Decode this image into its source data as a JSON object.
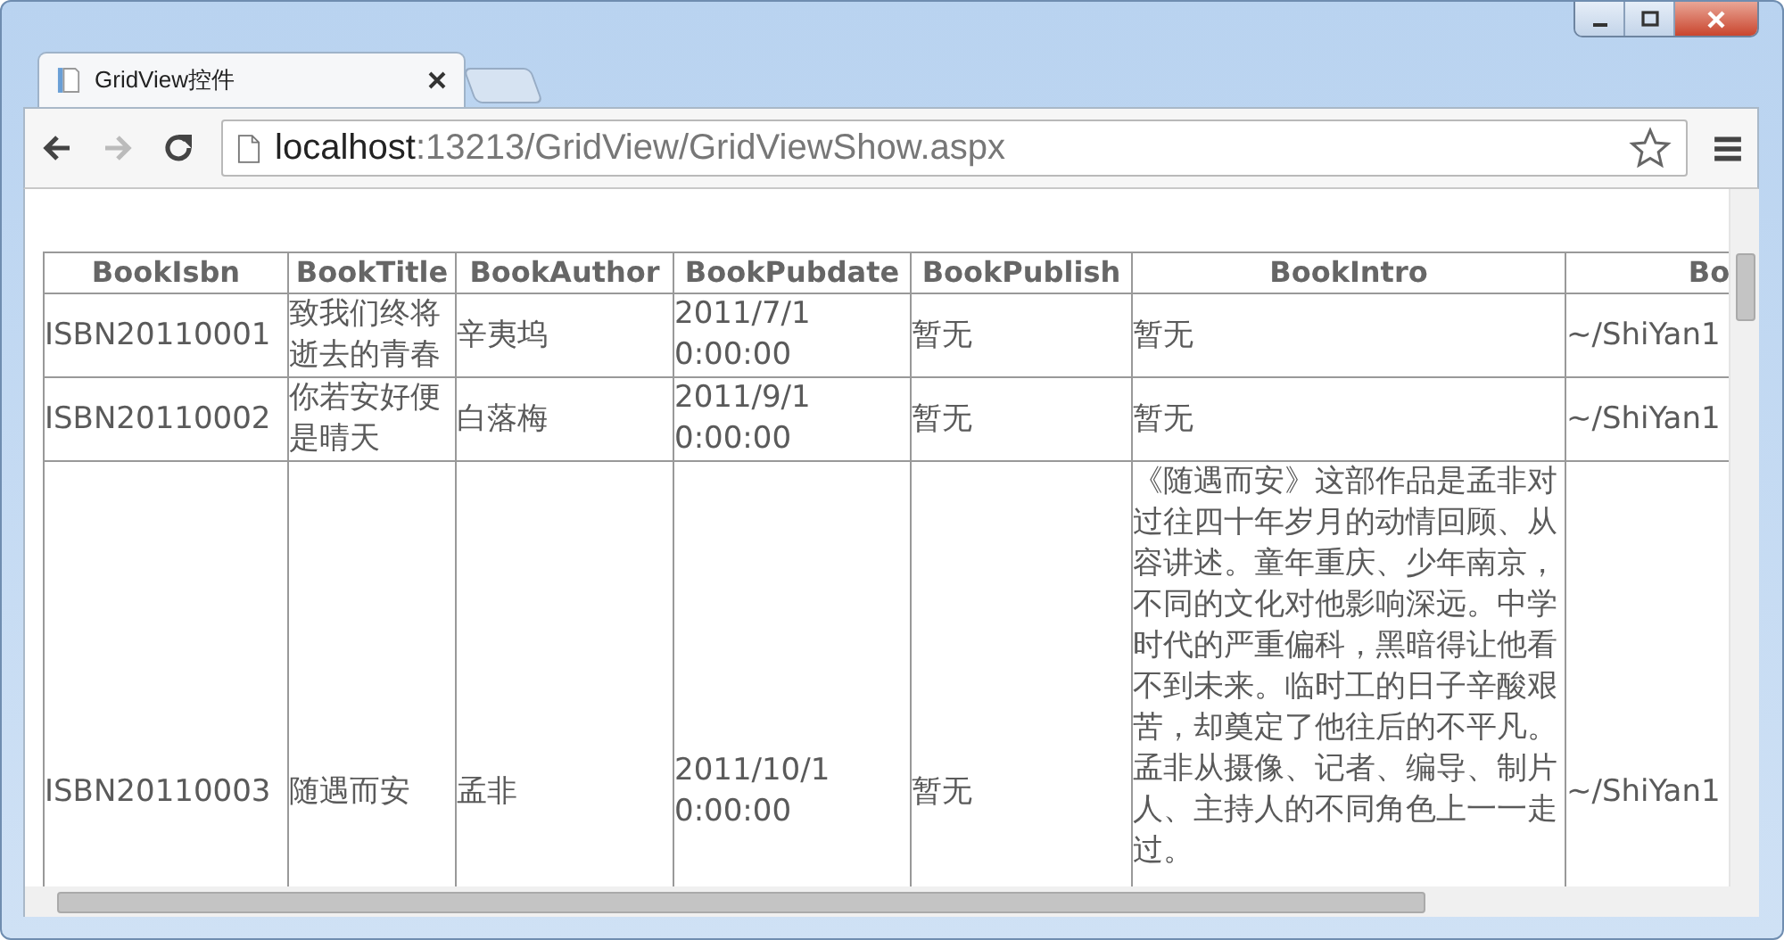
{
  "tabs": [
    {
      "title": "GridView控件",
      "selected": true
    }
  ],
  "toolbar": {
    "forward_disabled": true,
    "address": {
      "host": "localhost",
      "path": ":13213/GridView/GridViewShow.aspx"
    }
  },
  "table": {
    "columns": [
      "BookIsbn",
      "BookTitle",
      "BookAuthor",
      "BookPubdate",
      "BookPublish",
      "BookIntro",
      "Bo"
    ],
    "rows": [
      [
        "ISBN20110001",
        "致我们终将逝去的青春",
        "辛夷坞",
        "2011/7/1 0:00:00",
        "暂无",
        "暂无",
        "~/ShiYan1"
      ],
      [
        "ISBN20110002",
        "你若安好便是晴天",
        "白落梅",
        "2011/9/1 0:00:00",
        "暂无",
        "暂无",
        "~/ShiYan1"
      ],
      [
        "ISBN20110003",
        "随遇而安",
        "孟非",
        "2011/10/1 0:00:00",
        "暂无",
        "《随遇而安》这部作品是孟非对过往四十年岁月的动情回顾、从容讲述。童年重庆、少年南京，不同的文化对他影响深远。中学时代的严重偏科，黑暗得让他看不到未来。临时工的日子辛酸艰苦，却奠定了他往后的不平凡。孟非从摄像、记者、编导、制片人、主持人的不同角色上一一走过。",
        "~/ShiYan1"
      ]
    ]
  }
}
